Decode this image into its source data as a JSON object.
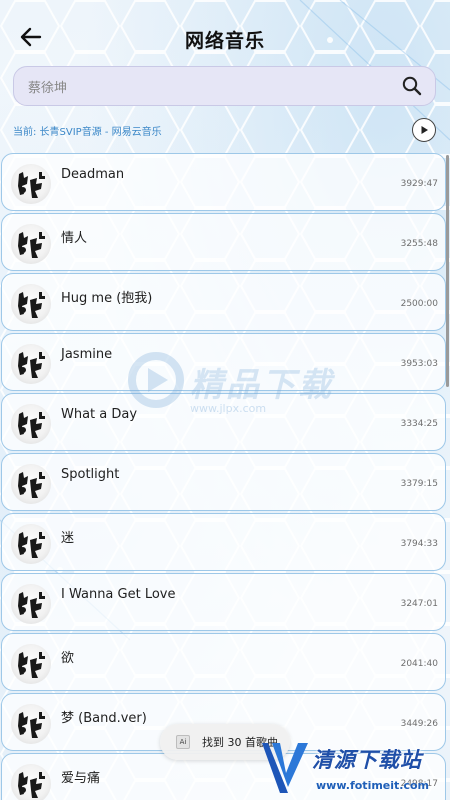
{
  "header": {
    "title": "网络音乐"
  },
  "search": {
    "value": "蔡徐坤",
    "placeholder": ""
  },
  "source": {
    "text": "当前: 长青SVIP音源 - 网易云音乐"
  },
  "songs": [
    {
      "name": "Deadman",
      "duration": "3929:47"
    },
    {
      "name": "情人",
      "duration": "3255:48"
    },
    {
      "name": "Hug me (抱我)",
      "duration": "2500:00"
    },
    {
      "name": "Jasmine",
      "duration": "3953:03"
    },
    {
      "name": "What a Day",
      "duration": "3334:25"
    },
    {
      "name": "Spotlight",
      "duration": "3379:15"
    },
    {
      "name": "迷",
      "duration": "3794:33"
    },
    {
      "name": "I Wanna Get Love",
      "duration": "3247:01"
    },
    {
      "name": "欲",
      "duration": "2041:40"
    },
    {
      "name": "梦 (Band.ver)",
      "duration": "3449:26"
    },
    {
      "name": "爱与痛",
      "duration": "2498:17"
    }
  ],
  "toast": {
    "text": "找到 30 首歌曲",
    "icon_label": "Ai"
  },
  "watermark": {
    "brand": "精品下载",
    "url": "www.jlpx.com"
  },
  "corner_logo": {
    "brand": "清源下载站",
    "url": "www.fotimeit.com"
  },
  "colors": {
    "accent": "#3c88c8",
    "row_border": "#9ec8e8",
    "search_bg": "#e6e6f6"
  },
  "icons": {
    "back": "arrow-left-icon",
    "search": "search-icon",
    "play": "play-circle-icon",
    "cover": "album-cover-icon"
  }
}
